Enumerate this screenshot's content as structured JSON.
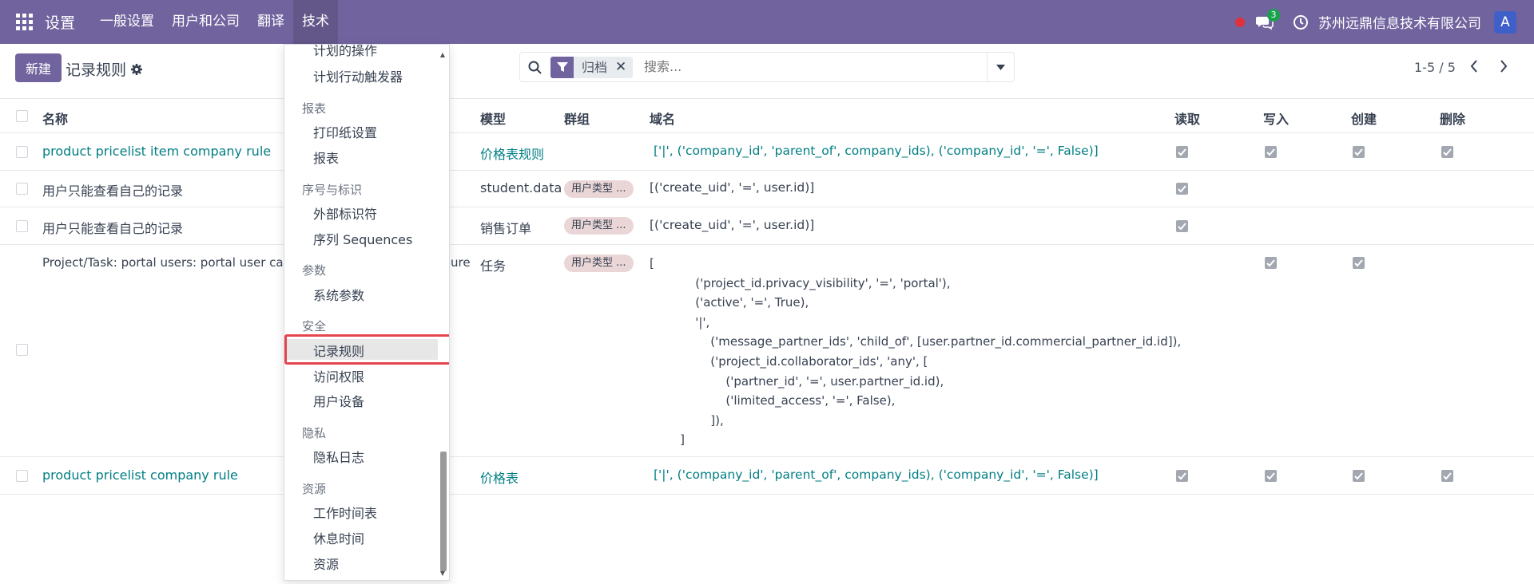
{
  "navbar": {
    "app_name": "设置",
    "menus": [
      "一般设置",
      "用户和公司",
      "翻译",
      "技术"
    ],
    "chat_count": "3",
    "company": "苏州远鼎信息技术有限公司",
    "avatar_letter": "A"
  },
  "control": {
    "new_button": "新建",
    "title": "记录规则",
    "facet_label": "归档",
    "search_placeholder": "搜索...",
    "pager": "1-5 / 5"
  },
  "columns": {
    "name": "名称",
    "model": "模型",
    "group": "群组",
    "domain": "域名",
    "read": "读取",
    "write": "写入",
    "create": "创建",
    "unlink": "删除"
  },
  "rows": [
    {
      "name": "product pricelist item company rule",
      "model": "价格表规则",
      "group": "",
      "domain": "['|', ('company_id', 'parent_of', company_ids), ('company_id', '=', False)]",
      "read": true,
      "write": true,
      "create": true,
      "unlink": true
    },
    {
      "name": "用户只能查看自己的记录",
      "model": "student.data",
      "group": "用户类型 ...",
      "domain": "[('create_uid', '=', user.id)]",
      "read": true,
      "write": false,
      "create": false,
      "unlink": false
    },
    {
      "name": "用户只能查看自己的记录",
      "model": "销售订单",
      "group": "用户类型 ...",
      "domain": "[('create_uid', '=', user.id)]",
      "read": true,
      "write": false,
      "create": false,
      "unlink": false
    },
    {
      "name": "Project/Task: portal users: portal user can",
      "name_tail": "ure",
      "model": "任务",
      "group": "用户类型 ...",
      "domain_lines": [
        "[",
        "            ('project_id.privacy_visibility', '=', 'portal'),",
        "            ('active', '=', True),",
        "            '|',",
        "                ('message_partner_ids', 'child_of', [user.partner_id.commercial_partner_id.id]),",
        "                ('project_id.collaborator_ids', 'any', [",
        "                    ('partner_id', '=', user.partner_id.id),",
        "                    ('limited_access', '=', False),",
        "                ]),",
        "        ]"
      ],
      "read": false,
      "write": true,
      "create": true,
      "unlink": false
    },
    {
      "name": "product pricelist company rule",
      "model": "价格表",
      "group": "",
      "domain": "['|', ('company_id', 'parent_of', company_ids), ('company_id', '=', False)]",
      "read": true,
      "write": true,
      "create": true,
      "unlink": true
    }
  ],
  "dropdown": {
    "cut_item": "计划的操作",
    "items_top": [
      "计划行动触发器"
    ],
    "sections": [
      {
        "header": "报表",
        "items": [
          "打印纸设置",
          "报表"
        ]
      },
      {
        "header": "序号与标识",
        "items": [
          "外部标识符",
          "序列 Sequences"
        ]
      },
      {
        "header": "参数",
        "items": [
          "系统参数"
        ]
      },
      {
        "header": "安全",
        "items": [
          "记录规则",
          "访问权限",
          "用户设备"
        ]
      },
      {
        "header": "隐私",
        "items": [
          "隐私日志"
        ]
      },
      {
        "header": "资源",
        "items": [
          "工作时间表",
          "休息时间",
          "资源"
        ]
      }
    ]
  },
  "colors": {
    "navbar": "#71639e",
    "link": "#017e84",
    "highlight": "#e5454f"
  }
}
